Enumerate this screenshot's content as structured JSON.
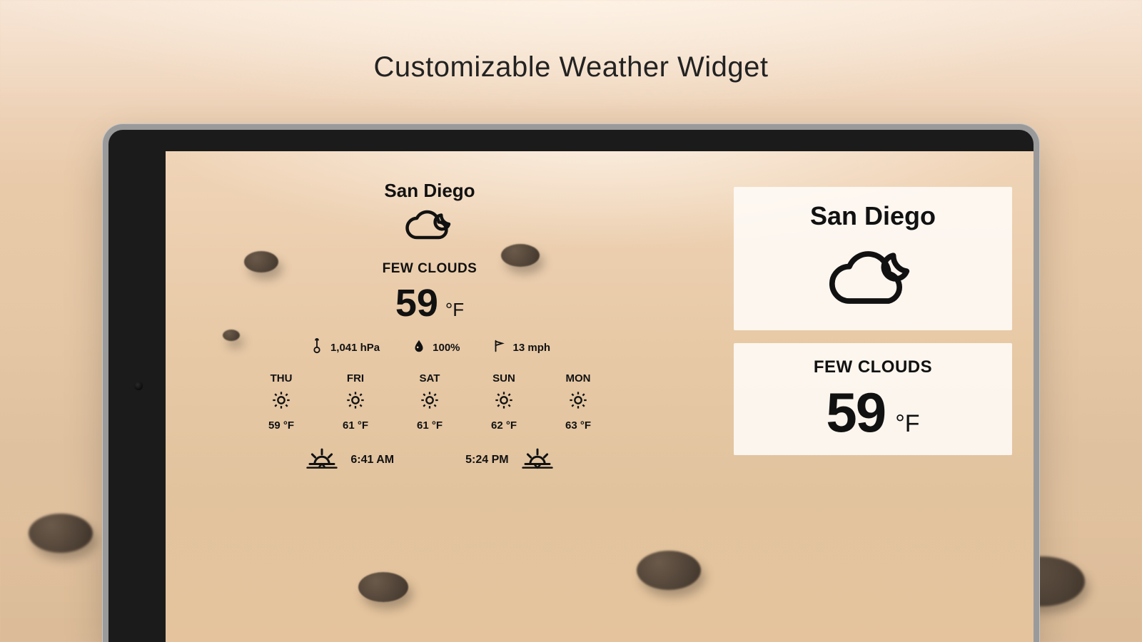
{
  "page": {
    "title": "Customizable Weather Widget"
  },
  "location": {
    "city": "San Diego"
  },
  "current": {
    "condition": "FEW CLOUDS",
    "temperature": "59",
    "unit": "°F",
    "pressure": "1,041 hPa",
    "humidity": "100%",
    "wind": "13 mph"
  },
  "forecast": [
    {
      "day": "THU",
      "temp": "59 °F"
    },
    {
      "day": "FRI",
      "temp": "61 °F"
    },
    {
      "day": "SAT",
      "temp": "61 °F"
    },
    {
      "day": "SUN",
      "temp": "62 °F"
    },
    {
      "day": "MON",
      "temp": "63 °F"
    }
  ],
  "sun": {
    "sunrise": "6:41 AM",
    "sunset": "5:24 PM"
  }
}
